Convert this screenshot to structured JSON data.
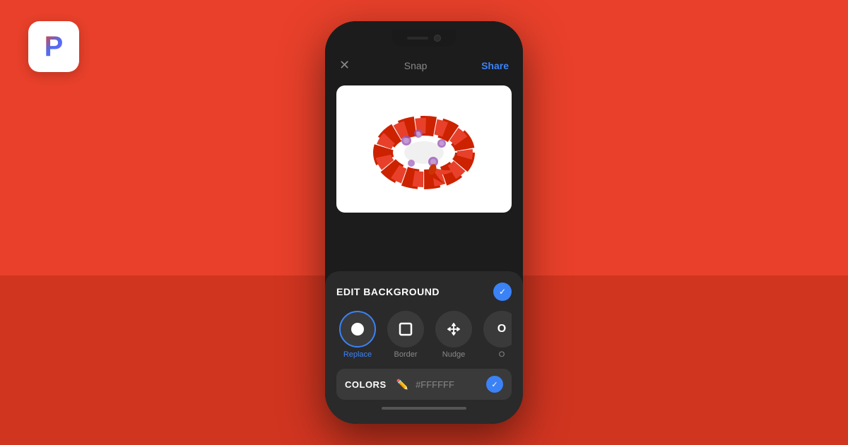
{
  "background": {
    "top_color": "#E8402A",
    "bottom_color": "#D03520"
  },
  "logo": {
    "letter": "P",
    "aria": "Podia logo"
  },
  "phone": {
    "header": {
      "close_label": "✕",
      "title": "Snap",
      "share_label": "Share"
    },
    "bottom_panel": {
      "edit_background_label": "EDIT BACKGROUND",
      "tools": [
        {
          "id": "replace",
          "label": "Replace",
          "icon": "●",
          "active": true
        },
        {
          "id": "border",
          "label": "Border",
          "icon": "▢",
          "active": false
        },
        {
          "id": "nudge",
          "label": "Nudge",
          "icon": "✛",
          "active": false
        },
        {
          "id": "opacity",
          "label": "O",
          "icon": "",
          "active": false
        }
      ],
      "colors_section": {
        "label": "COLORS",
        "hex_value": "#FFFFFF"
      }
    }
  }
}
